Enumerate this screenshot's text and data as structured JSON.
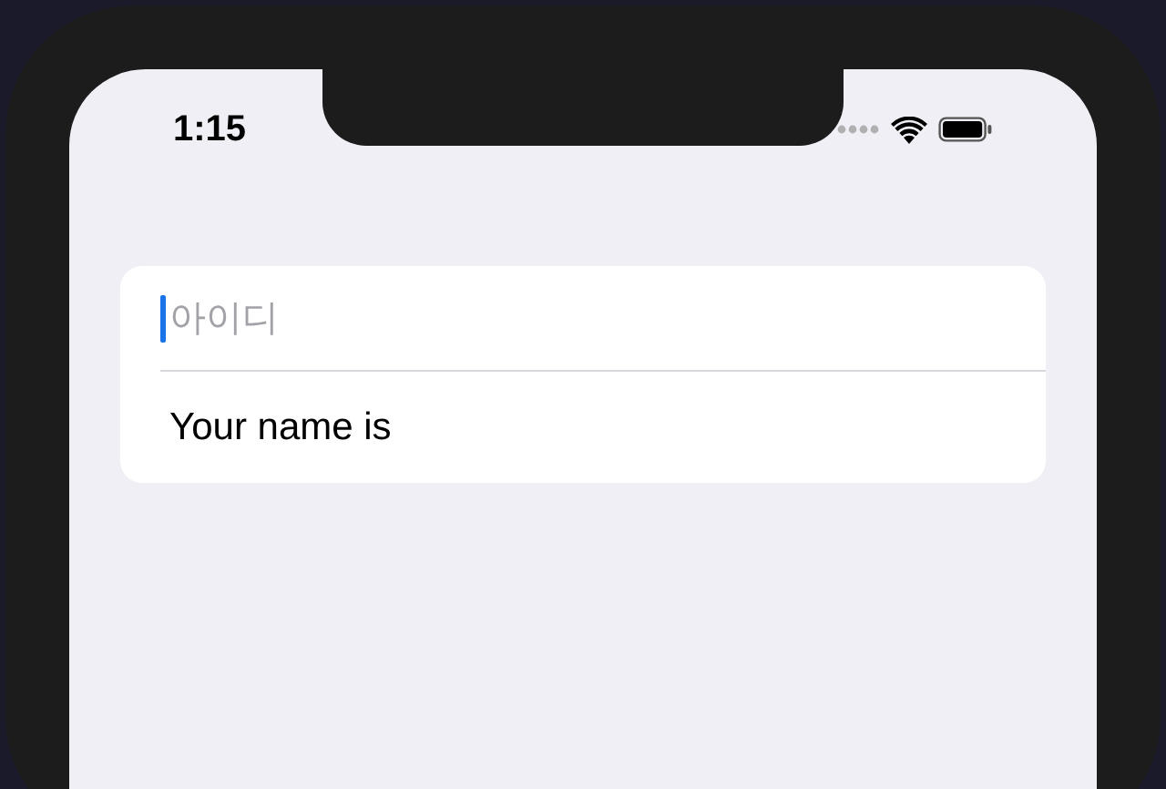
{
  "status_bar": {
    "time": "1:15"
  },
  "form": {
    "field": {
      "placeholder": "아이디",
      "focused": true
    },
    "name_label": "Your name is"
  }
}
